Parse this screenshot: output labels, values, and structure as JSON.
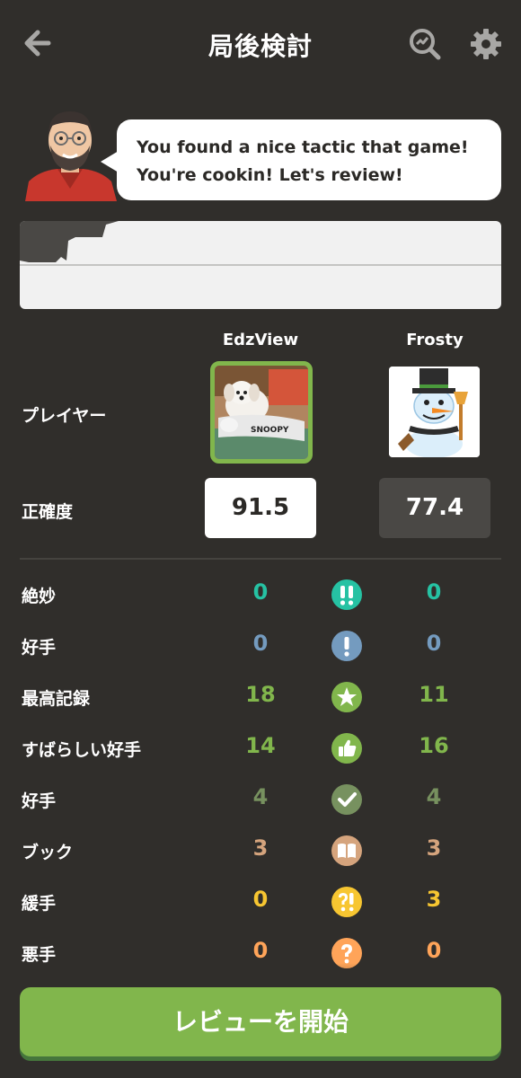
{
  "header": {
    "title": "局後検討"
  },
  "coach": {
    "message_line1": "You found a nice tactic that game!",
    "message_line2": "You're cookin! Let's review!"
  },
  "players": {
    "label": "プレイヤー",
    "white": {
      "name": "EdzView",
      "accuracy": "91.5"
    },
    "black": {
      "name": "Frosty",
      "accuracy": "77.4"
    }
  },
  "accuracy_label": "正確度",
  "stats": [
    {
      "label": "絶妙",
      "left": "0",
      "right": "0",
      "color": "#26c2a3",
      "icon": "brilliant-icon"
    },
    {
      "label": "好手",
      "left": "0",
      "right": "0",
      "color": "#749bbf",
      "icon": "great-move-icon"
    },
    {
      "label": "最高記録",
      "left": "18",
      "right": "11",
      "color": "#81b64c",
      "icon": "best-move-icon"
    },
    {
      "label": "すばらしい好手",
      "left": "14",
      "right": "16",
      "color": "#81b64c",
      "icon": "excellent-icon"
    },
    {
      "label": "好手",
      "left": "4",
      "right": "4",
      "color": "#77915f",
      "icon": "good-move-icon"
    },
    {
      "label": "ブック",
      "left": "3",
      "right": "3",
      "color": "#d5a47d",
      "icon": "book-icon"
    },
    {
      "label": "緩手",
      "left": "0",
      "right": "3",
      "color": "#f7c631",
      "icon": "inaccuracy-icon"
    },
    {
      "label": "悪手",
      "left": "0",
      "right": "0",
      "color": "#ffa459",
      "icon": "mistake-icon"
    }
  ],
  "start_button": "レビューを開始"
}
